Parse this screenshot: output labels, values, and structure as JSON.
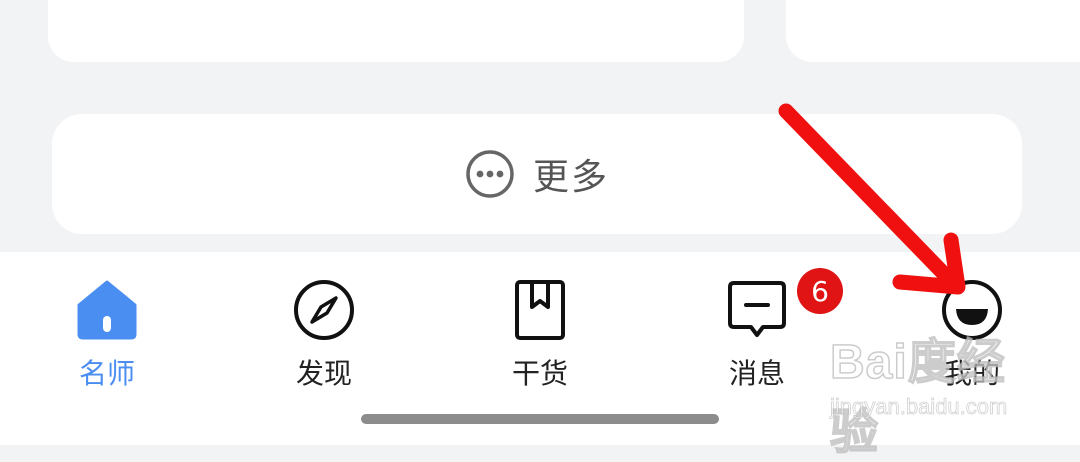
{
  "more_section": {
    "label": "更多",
    "icon": "more-dots-icon"
  },
  "tab_bar": {
    "items": [
      {
        "label": "名师",
        "icon": "home-icon",
        "active": true
      },
      {
        "label": "发现",
        "icon": "compass-icon",
        "active": false
      },
      {
        "label": "干货",
        "icon": "bookmark-book-icon",
        "active": false
      },
      {
        "label": "消息",
        "icon": "message-icon",
        "active": false,
        "badge": "6"
      },
      {
        "label": "我的",
        "icon": "smiley-face-icon",
        "active": false
      }
    ]
  },
  "colors": {
    "accent": "#4a8ef1",
    "badge": "#e01414",
    "annotation_arrow": "#f01010",
    "page_background": "#f2f3f5"
  },
  "watermark": {
    "logo": "Bai度经验",
    "url": "jingyan.baidu.com"
  },
  "annotation": {
    "type": "arrow",
    "points_to": "tab-mine"
  }
}
